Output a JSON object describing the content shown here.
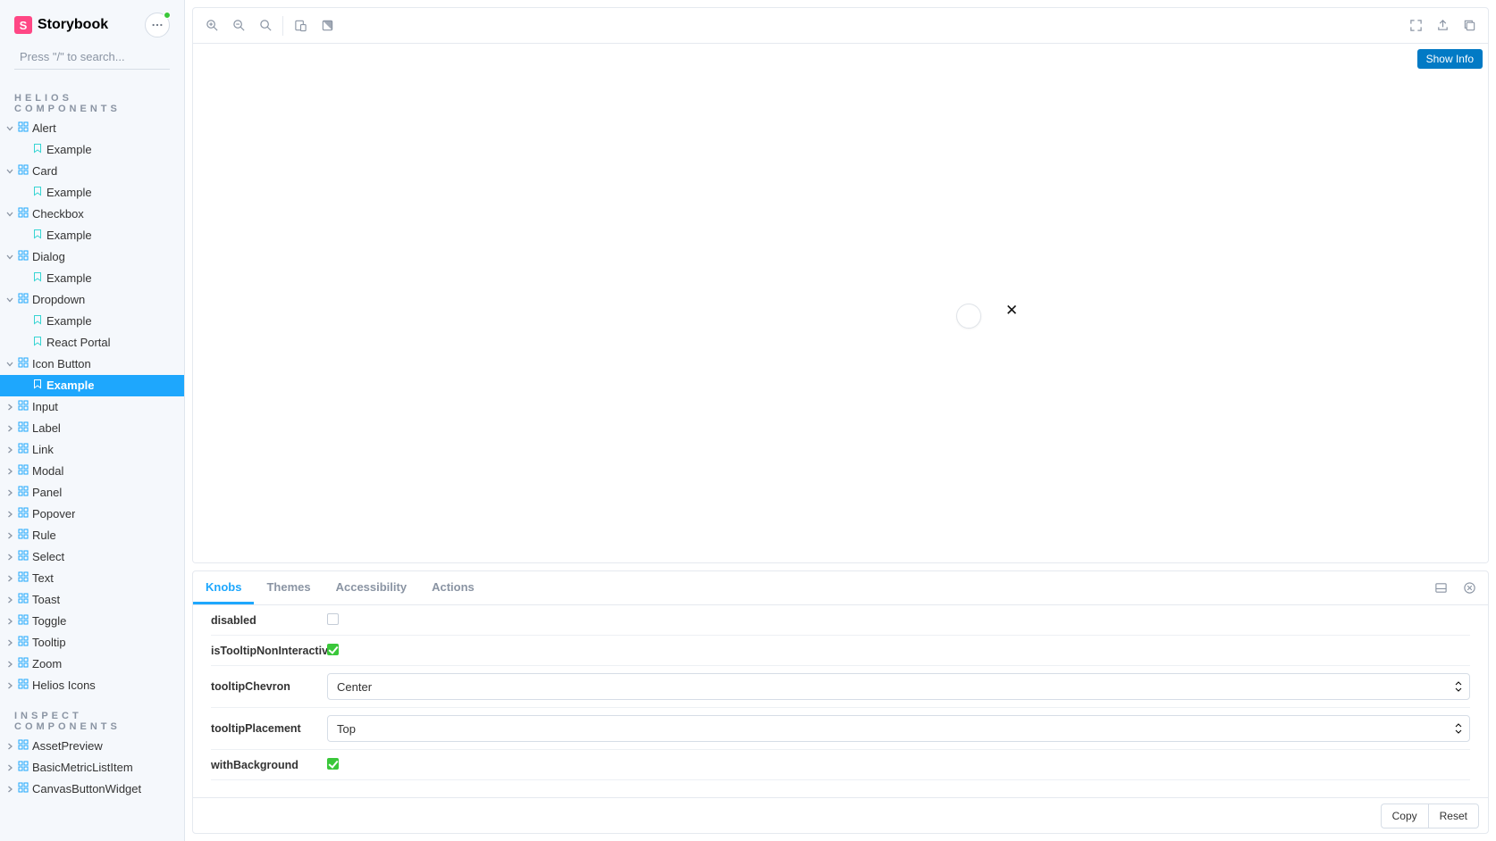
{
  "brand": {
    "name": "Storybook",
    "mark_letter": "S"
  },
  "search": {
    "placeholder": "Press \"/\" to search..."
  },
  "sections": [
    {
      "title": "HELIOS COMPONENTS"
    },
    {
      "title": "INSPECT COMPONENTS"
    }
  ],
  "tree_helios": [
    {
      "label": "Alert",
      "expanded": true,
      "children": [
        {
          "label": "Example"
        }
      ]
    },
    {
      "label": "Card",
      "expanded": true,
      "children": [
        {
          "label": "Example"
        }
      ]
    },
    {
      "label": "Checkbox",
      "expanded": true,
      "children": [
        {
          "label": "Example"
        }
      ]
    },
    {
      "label": "Dialog",
      "expanded": true,
      "children": [
        {
          "label": "Example"
        }
      ]
    },
    {
      "label": "Dropdown",
      "expanded": true,
      "children": [
        {
          "label": "Example"
        },
        {
          "label": "React Portal"
        }
      ]
    },
    {
      "label": "Icon Button",
      "expanded": true,
      "children": [
        {
          "label": "Example",
          "selected": true
        }
      ]
    },
    {
      "label": "Input",
      "expanded": false
    },
    {
      "label": "Label",
      "expanded": false
    },
    {
      "label": "Link",
      "expanded": false
    },
    {
      "label": "Modal",
      "expanded": false
    },
    {
      "label": "Panel",
      "expanded": false
    },
    {
      "label": "Popover",
      "expanded": false
    },
    {
      "label": "Rule",
      "expanded": false
    },
    {
      "label": "Select",
      "expanded": false
    },
    {
      "label": "Text",
      "expanded": false
    },
    {
      "label": "Toast",
      "expanded": false
    },
    {
      "label": "Toggle",
      "expanded": false
    },
    {
      "label": "Tooltip",
      "expanded": false
    },
    {
      "label": "Zoom",
      "expanded": false
    },
    {
      "label": "Helios Icons",
      "expanded": false
    }
  ],
  "tree_inspect": [
    {
      "label": "AssetPreview",
      "expanded": false
    },
    {
      "label": "BasicMetricListItem",
      "expanded": false
    },
    {
      "label": "CanvasButtonWidget",
      "expanded": false
    }
  ],
  "toolbar": {
    "left": [
      "zoom-in",
      "zoom-out",
      "zoom-reset",
      "sep",
      "viewport",
      "theme-toggle"
    ],
    "right": [
      "fullscreen",
      "open-new",
      "copy-link"
    ]
  },
  "show_info_label": "Show Info",
  "addon_tabs": [
    {
      "label": "Knobs",
      "active": true
    },
    {
      "label": "Themes"
    },
    {
      "label": "Accessibility"
    },
    {
      "label": "Actions"
    }
  ],
  "knobs": [
    {
      "name": "disabled",
      "type": "bool",
      "value": false
    },
    {
      "name": "isTooltipNonInteractive",
      "type": "bool",
      "value": true
    },
    {
      "name": "tooltipChevron",
      "type": "select",
      "value": "Center"
    },
    {
      "name": "tooltipPlacement",
      "type": "select",
      "value": "Top"
    },
    {
      "name": "withBackground",
      "type": "bool",
      "value": true
    }
  ],
  "addon_footer": {
    "copy": "Copy",
    "reset": "Reset"
  }
}
